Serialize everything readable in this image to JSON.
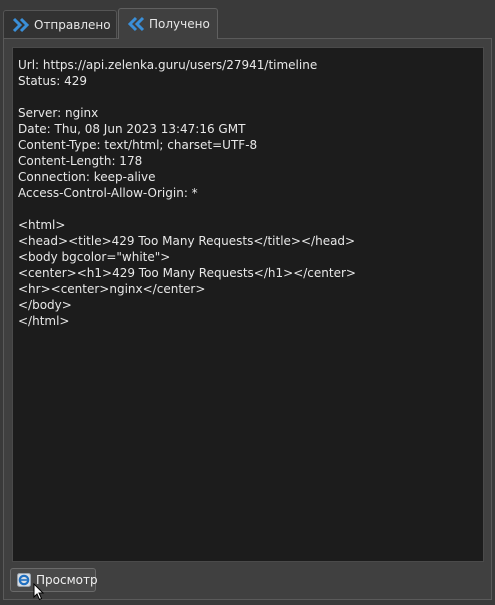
{
  "tabs": {
    "sent_label": "Отправлено",
    "received_label": "Получено"
  },
  "response": {
    "url_line": "Url: https://api.zelenka.guru/users/27941/timeline",
    "status_line": "Status: 429",
    "headers": [
      "Server: nginx",
      "Date: Thu, 08 Jun 2023 13:47:16 GMT",
      "Content-Type: text/html; charset=UTF-8",
      "Content-Length: 178",
      "Connection: keep-alive",
      "Access-Control-Allow-Origin: *"
    ],
    "body": [
      "<html>",
      "<head><title>429 Too Many Requests</title></head>",
      "<body bgcolor=\"white\">",
      "<center><h1>429 Too Many Requests</h1></center>",
      "<hr><center>nginx</center>",
      "</body>",
      "</html>"
    ]
  },
  "footer": {
    "preview_label": "Просмотр"
  },
  "colors": {
    "accent": "#3a8fd8",
    "background": "#3a3a3a",
    "content_bg": "#1c1c1c"
  }
}
